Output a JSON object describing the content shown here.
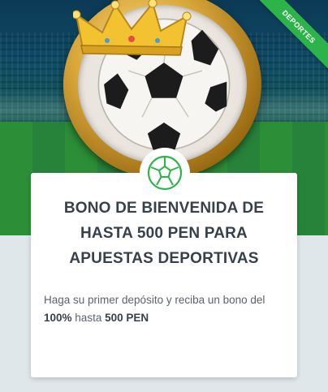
{
  "promo": {
    "ribbon_label": "DEPORTES",
    "title_line1": "BONO DE BIENVENIDA DE",
    "title_line2": "HASTA 500 PEN PARA",
    "title_line3": "APUESTAS DEPORTIVAS",
    "text_part1": "Haga su primer depósito y reciba un bono del",
    "text_percent": "100%",
    "text_middle": "hasta",
    "text_amount": "500 PEN"
  },
  "colors": {
    "ribbon": "#2cb34a",
    "icon_green": "#2cb34a",
    "title": "#37414a",
    "background": "#dfe7ea"
  },
  "icons": {
    "badge": "soccer-ball-icon"
  }
}
